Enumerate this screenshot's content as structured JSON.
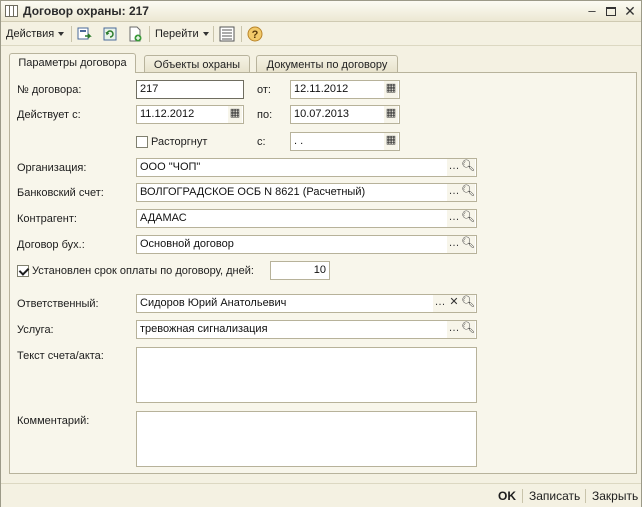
{
  "window": {
    "title": "Договор охраны: 217"
  },
  "toolbar": {
    "actions_label": "Действия",
    "goto_label": "Перейти"
  },
  "tabs": [
    {
      "label": "Параметры договора"
    },
    {
      "label": "Объекты охраны"
    },
    {
      "label": "Документы по договору"
    }
  ],
  "form": {
    "contract_no_label": "№ договора:",
    "contract_no_value": "217",
    "from_label": "от:",
    "from_value": "12.11.2012",
    "valid_from_label": "Действует с:",
    "valid_from_value": "11.12.2012",
    "to_label": "по:",
    "to_value": "10.07.2013",
    "terminated_label": "Расторгнут",
    "terminated_since_label": "с:",
    "terminated_since_value": " .  .",
    "organization_label": "Организация:",
    "organization_value": "ООО \"ЧОП\"",
    "bank_account_label": "Банковский счет:",
    "bank_account_value": "ВОЛГОГРАДСКОЕ ОСБ N 8621 (Расчетный)",
    "counterparty_label": "Контрагент:",
    "counterparty_value": "АДАМАС",
    "acc_contract_label": "Договор бух.:",
    "acc_contract_value": "Основной договор",
    "payment_term_label": "Установлен срок оплаты по договору, дней:",
    "payment_term_value": "10",
    "responsible_label": "Ответственный:",
    "responsible_value": "Сидоров Юрий Анатольевич",
    "service_label": "Услуга:",
    "service_value": "тревожная сигнализация",
    "invoice_text_label": "Текст счета/акта:",
    "comment_label": "Комментарий:"
  },
  "footer": {
    "ok_label": "OK",
    "save_label": "Записать",
    "close_label": "Закрыть"
  }
}
